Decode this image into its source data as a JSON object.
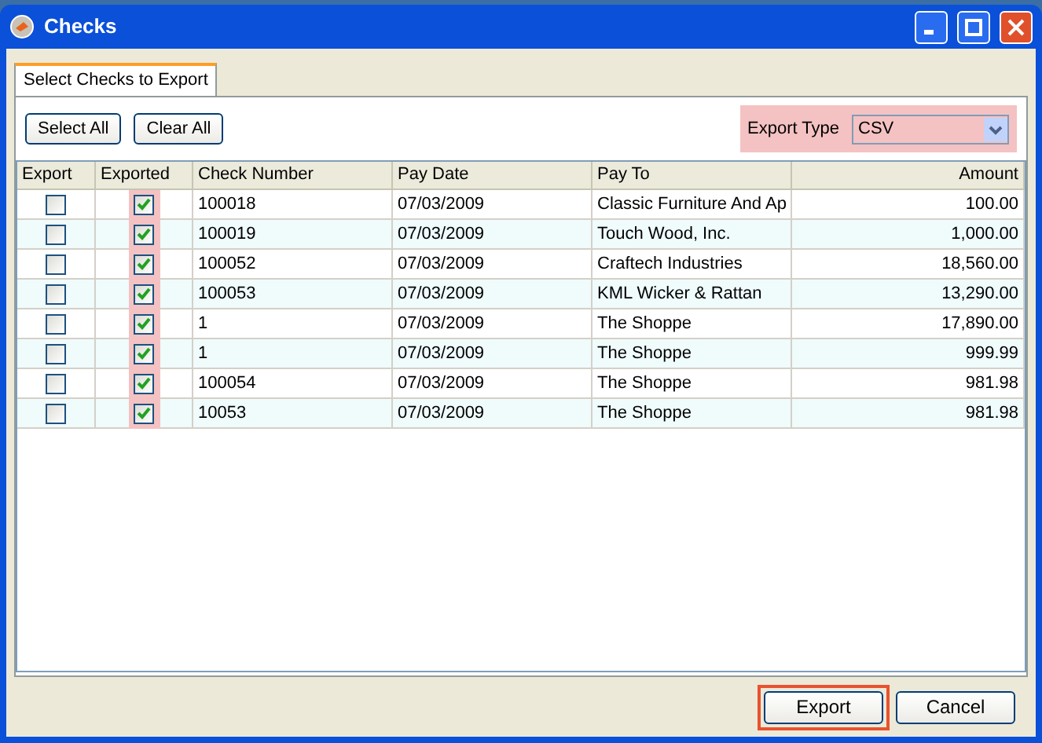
{
  "window": {
    "title": "Checks"
  },
  "tabs": [
    {
      "label": "Select Checks to Export",
      "selected": true
    }
  ],
  "toolbar": {
    "buttons": [
      "Select All",
      "Clear All"
    ],
    "export_type": {
      "label": "Export Type",
      "value": "CSV",
      "highlighted": true
    }
  },
  "table": {
    "columns": [
      {
        "label": "Export"
      },
      {
        "label": "Exported",
        "highlighted": true
      },
      {
        "label": "Check Number"
      },
      {
        "label": "Pay Date"
      },
      {
        "label": "Pay To"
      },
      {
        "label": "Amount"
      }
    ],
    "rows": [
      {
        "export": false,
        "exported": true,
        "check_number": "100018",
        "pay_date": "07/03/2009",
        "pay_to": "Classic Furniture And Ap",
        "amount": "100.00"
      },
      {
        "export": false,
        "exported": true,
        "check_number": "100019",
        "pay_date": "07/03/2009",
        "pay_to": "Touch Wood, Inc.",
        "amount": "1,000.00"
      },
      {
        "export": false,
        "exported": true,
        "check_number": "100052",
        "pay_date": "07/03/2009",
        "pay_to": "Craftech Industries",
        "amount": "18,560.00"
      },
      {
        "export": false,
        "exported": true,
        "check_number": "100053",
        "pay_date": "07/03/2009",
        "pay_to": "KML Wicker & Rattan",
        "amount": "13,290.00"
      },
      {
        "export": false,
        "exported": true,
        "check_number": "1",
        "pay_date": "07/03/2009",
        "pay_to": "The Shoppe",
        "amount": "17,890.00"
      },
      {
        "export": false,
        "exported": true,
        "check_number": "1",
        "pay_date": "07/03/2009",
        "pay_to": "The Shoppe",
        "amount": "999.99"
      },
      {
        "export": false,
        "exported": true,
        "check_number": "100054",
        "pay_date": "07/03/2009",
        "pay_to": "The Shoppe",
        "amount": "981.98"
      },
      {
        "export": false,
        "exported": true,
        "check_number": "10053",
        "pay_date": "07/03/2009",
        "pay_to": "The Shoppe",
        "amount": "981.98"
      }
    ]
  },
  "footer_buttons": [
    {
      "label": "Export",
      "highlighted": true
    },
    {
      "label": "Cancel",
      "highlighted": false
    }
  ]
}
